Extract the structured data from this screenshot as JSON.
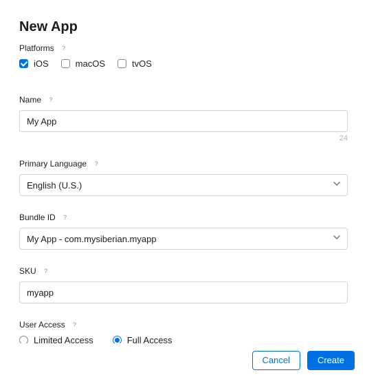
{
  "title": "New App",
  "platforms": {
    "label": "Platforms",
    "options": [
      {
        "label": "iOS",
        "checked": true
      },
      {
        "label": "macOS",
        "checked": false
      },
      {
        "label": "tvOS",
        "checked": false
      }
    ]
  },
  "name": {
    "label": "Name",
    "value": "My App",
    "char_count": "24"
  },
  "primary_language": {
    "label": "Primary Language",
    "value": "English (U.S.)"
  },
  "bundle_id": {
    "label": "Bundle ID",
    "value": "My App - com.mysiberian.myapp"
  },
  "sku": {
    "label": "SKU",
    "value": "myapp"
  },
  "user_access": {
    "label": "User Access",
    "options": [
      {
        "label": "Limited Access",
        "selected": false
      },
      {
        "label": "Full Access",
        "selected": true
      }
    ]
  },
  "footer": {
    "cancel": "Cancel",
    "create": "Create"
  }
}
